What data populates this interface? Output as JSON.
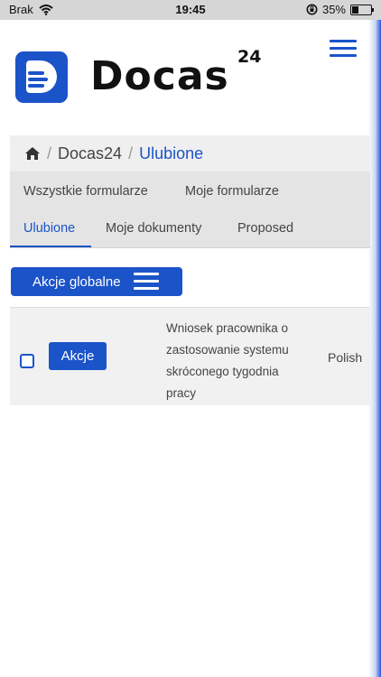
{
  "status_bar": {
    "carrier": "Brak",
    "time": "19:45",
    "battery": "35%",
    "battery_level": 0.35,
    "icons": [
      "wifi-icon",
      "orientation-lock-icon",
      "battery-icon"
    ]
  },
  "header": {
    "brand": "Docas",
    "brand_sup": "24",
    "icons": [
      "docas-logo-icon",
      "hamburger-menu-icon"
    ]
  },
  "breadcrumb": {
    "items": [
      "Docas24",
      "Ulubione"
    ],
    "separator": "/",
    "icons": [
      "home-icon"
    ]
  },
  "tabs": {
    "items": [
      "Wszystkie formularze",
      "Moje formularze",
      "Ulubione",
      "Moje dokumenty",
      "Proposed"
    ],
    "active": "Ulubione"
  },
  "toolbar": {
    "global_actions_label": "Akcje globalne",
    "icons": [
      "menu-icon"
    ]
  },
  "documents": [
    {
      "action_label": "Akcje",
      "title": "Wniosek pracownika o zastosowanie systemu skróconego tygodnia pracy",
      "language": "Polish",
      "checked": false
    }
  ],
  "colors": {
    "accent": "#1b53c9",
    "breadcrumb_bg": "#efefef",
    "tabs_bg": "#e4e4e4",
    "row_bg": "#f1f1f1",
    "status_bar_bg": "#d6d6d6"
  }
}
